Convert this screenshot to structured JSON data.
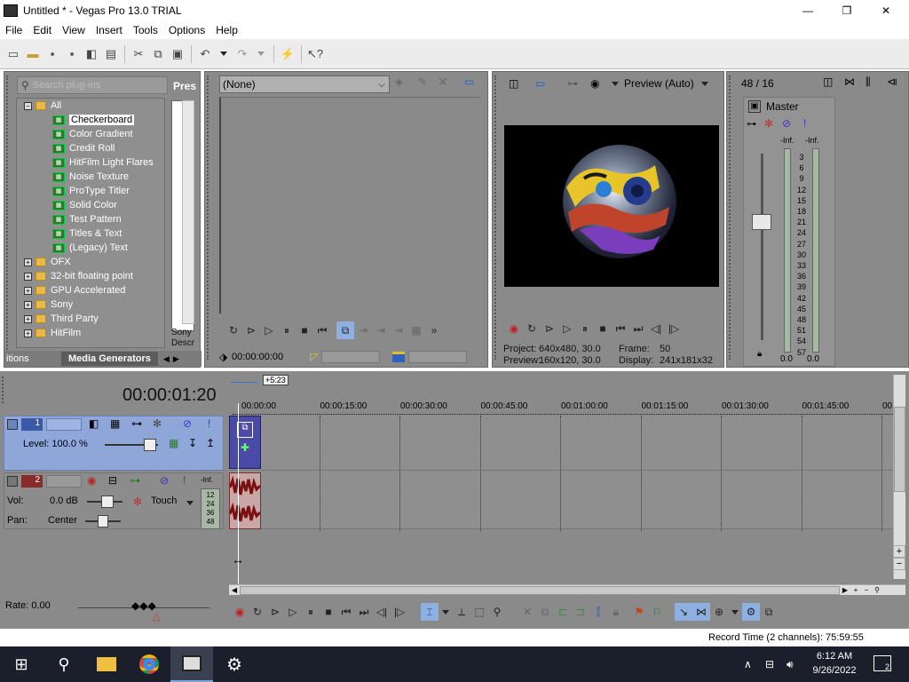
{
  "window": {
    "title": "Untitled * - Vegas Pro 13.0 TRIAL",
    "minimize": "—",
    "maximize": "❐",
    "close": "✕"
  },
  "menu": [
    "File",
    "Edit",
    "View",
    "Insert",
    "Tools",
    "Options",
    "Help"
  ],
  "explorer": {
    "search_placeholder": "Search plug-ins",
    "pres_label": "Pres",
    "tree": [
      {
        "label": "All",
        "type": "folder-open"
      },
      {
        "label": "Checkerboard",
        "type": "gen",
        "selected": true
      },
      {
        "label": "Color Gradient",
        "type": "gen"
      },
      {
        "label": "Credit Roll",
        "type": "gen"
      },
      {
        "label": "HitFilm Light Flares",
        "type": "gen"
      },
      {
        "label": "Noise Texture",
        "type": "gen"
      },
      {
        "label": "ProType Titler",
        "type": "gen"
      },
      {
        "label": "Solid Color",
        "type": "gen"
      },
      {
        "label": "Test Pattern",
        "type": "gen"
      },
      {
        "label": "Titles & Text",
        "type": "gen"
      },
      {
        "label": "(Legacy) Text",
        "type": "gen"
      },
      {
        "label": "OFX",
        "type": "folder"
      },
      {
        "label": "32-bit floating point",
        "type": "folder"
      },
      {
        "label": "GPU Accelerated",
        "type": "folder"
      },
      {
        "label": "Sony",
        "type": "folder"
      },
      {
        "label": "Third Party",
        "type": "folder"
      },
      {
        "label": "HitFilm",
        "type": "folder"
      }
    ],
    "side_label_1": "Sony",
    "side_label_2": "Descr",
    "tab_left": "itions",
    "tab_active": "Media Generators"
  },
  "trimmer": {
    "dropdown_value": "(None)",
    "timecode": "00:00:00:00"
  },
  "preview": {
    "mode_label": "Preview (Auto)",
    "project_label": "Project:",
    "project_value": "640x480, 30.0",
    "preview_label": "Preview:",
    "preview_value": "160x120, 30.0",
    "frame_label": "Frame:",
    "frame_value": "50",
    "display_label": "Display:",
    "display_value": "241x181x32"
  },
  "master": {
    "rate": "48 / 16",
    "title": "Master",
    "inf_l": "-Inf.",
    "inf_r": "-Inf.",
    "scale": [
      "3",
      "6",
      "9",
      "12",
      "15",
      "18",
      "21",
      "24",
      "27",
      "30",
      "33",
      "36",
      "39",
      "42",
      "45",
      "48",
      "51",
      "54",
      "57"
    ],
    "bottom_l": "0.0",
    "bottom_r": "0.0"
  },
  "timeline": {
    "cursor_time": "00:00:01:20",
    "marker_label": "+5:23",
    "ruler": [
      "00:00:00",
      "00:00:15:00",
      "00:00:30:00",
      "00:00:45:00",
      "00:01:00:00",
      "00:01:15:00",
      "00:01:30:00",
      "00:01:45:00",
      "00:0"
    ],
    "video_track": {
      "number": "1",
      "level": "Level: 100.0 %"
    },
    "audio_track": {
      "number": "2",
      "vol_label": "Vol:",
      "vol_value": "0.0 dB",
      "pan_label": "Pan:",
      "pan_value": "Center",
      "touch": "Touch",
      "meter_top": "-Inf.",
      "meter_scale": [
        "12",
        "24",
        "36",
        "48"
      ]
    },
    "rate": "Rate: 0.00",
    "status": "Record Time (2 channels): 75:59:55"
  },
  "taskbar": {
    "time": "6:12 AM",
    "date": "9/26/2022",
    "notif_count": "2"
  },
  "colors": {
    "panel": "#8a8a8a",
    "video_track": "#8fa6d8",
    "clip_video": "#4a4aa8",
    "taskbar": "#1a1f2b"
  }
}
